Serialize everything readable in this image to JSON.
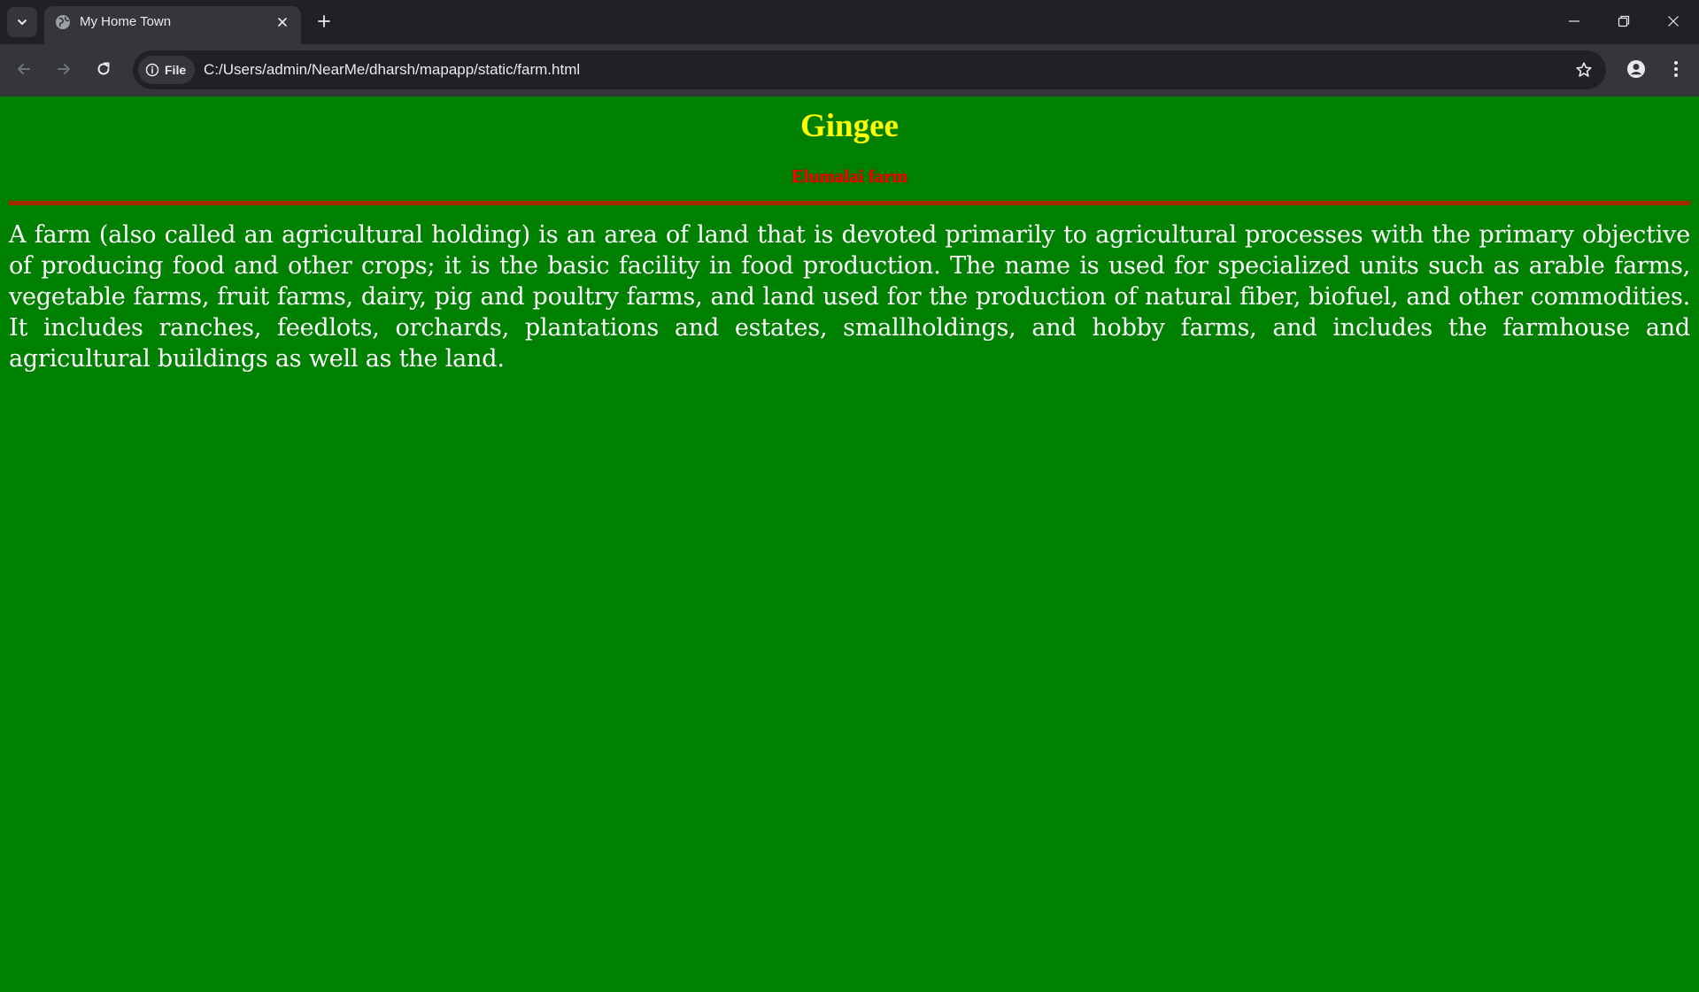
{
  "browser": {
    "tab": {
      "title": "My Home Town",
      "favicon": "globe-icon"
    },
    "address_bar": {
      "chip_label": "File",
      "url": "C:/Users/admin/NearMe/dharsh/mapapp/static/farm.html"
    },
    "icons": {
      "tab_search": "chevron-down-icon",
      "tab_close": "close-icon",
      "new_tab": "plus-icon",
      "minimize": "minimize-icon",
      "restore": "restore-icon",
      "close_window": "close-icon",
      "back": "arrow-left-icon",
      "forward": "arrow-right-icon",
      "reload": "reload-icon",
      "site_info": "info-icon",
      "bookmark": "star-icon",
      "profile": "person-icon",
      "menu": "kebab-menu-icon"
    },
    "colors": {
      "frame": "#202124",
      "toolbar": "#35363a",
      "text": "#e8eaed"
    }
  },
  "page": {
    "heading": "Gingee",
    "subheading": "Elumalai farm",
    "paragraph": "A farm (also called an agricultural holding) is an area of land that is devoted primarily to agricultural processes with the primary objective of producing food and other crops; it is the basic facility in food production. The name is used for specialized units such as arable farms, vegetable farms, fruit farms, dairy, pig and poultry farms, and land used for the production of natural fiber, biofuel, and other commodities. It includes ranches, feedlots, orchards, plantations and estates, smallholdings, and hobby farms, and includes the farmhouse and agricultural buildings as well as the land.",
    "colors": {
      "background": "#008000",
      "heading": "#ffff00",
      "subheading": "#ff0000",
      "divider": "#a52a00",
      "paragraph": "#ffffff"
    }
  }
}
